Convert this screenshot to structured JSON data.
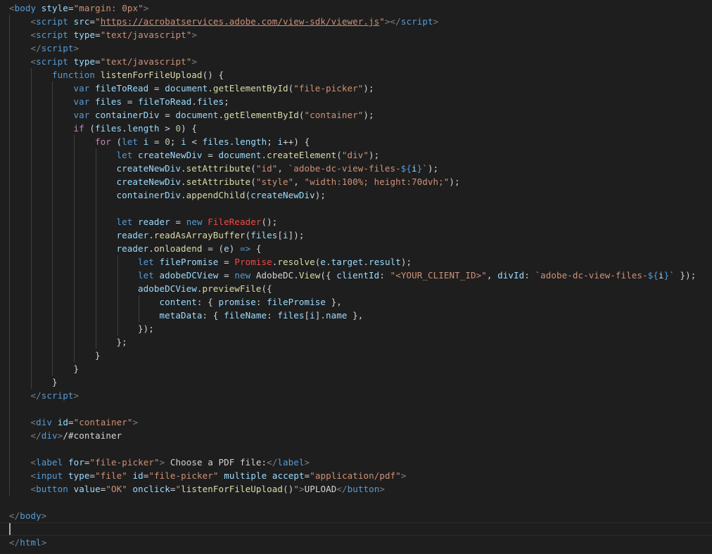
{
  "code_lines": [
    [
      {
        "t": "<",
        "c": "tag-punct"
      },
      {
        "t": "body",
        "c": "tag-name"
      },
      {
        "t": " ",
        "c": "plain"
      },
      {
        "t": "style",
        "c": "attr"
      },
      {
        "t": "=",
        "c": "plain"
      },
      {
        "t": "\"margin: 0px\"",
        "c": "str"
      },
      {
        "t": ">",
        "c": "tag-punct"
      }
    ],
    [
      {
        "t": "    ",
        "c": "plain"
      },
      {
        "t": "<",
        "c": "tag-punct"
      },
      {
        "t": "script",
        "c": "tag-name"
      },
      {
        "t": " ",
        "c": "plain"
      },
      {
        "t": "src",
        "c": "attr"
      },
      {
        "t": "=",
        "c": "plain"
      },
      {
        "t": "\"",
        "c": "str"
      },
      {
        "t": "https://acrobatservices.adobe.com/view-sdk/viewer.js",
        "c": "url"
      },
      {
        "t": "\"",
        "c": "str"
      },
      {
        "t": "></",
        "c": "tag-punct"
      },
      {
        "t": "script",
        "c": "tag-name"
      },
      {
        "t": ">",
        "c": "tag-punct"
      }
    ],
    [
      {
        "t": "    ",
        "c": "plain"
      },
      {
        "t": "<",
        "c": "tag-punct"
      },
      {
        "t": "script",
        "c": "tag-name"
      },
      {
        "t": " ",
        "c": "plain"
      },
      {
        "t": "type",
        "c": "attr"
      },
      {
        "t": "=",
        "c": "plain"
      },
      {
        "t": "\"text/javascript\"",
        "c": "str"
      },
      {
        "t": ">",
        "c": "tag-punct"
      }
    ],
    [
      {
        "t": "    ",
        "c": "plain"
      },
      {
        "t": "</",
        "c": "tag-punct"
      },
      {
        "t": "script",
        "c": "tag-name"
      },
      {
        "t": ">",
        "c": "tag-punct"
      }
    ],
    [
      {
        "t": "    ",
        "c": "plain"
      },
      {
        "t": "<",
        "c": "tag-punct"
      },
      {
        "t": "script",
        "c": "tag-name"
      },
      {
        "t": " ",
        "c": "plain"
      },
      {
        "t": "type",
        "c": "attr"
      },
      {
        "t": "=",
        "c": "plain"
      },
      {
        "t": "\"text/javascript\"",
        "c": "str"
      },
      {
        "t": ">",
        "c": "tag-punct"
      }
    ],
    [
      {
        "t": "        ",
        "c": "plain"
      },
      {
        "t": "function",
        "c": "kw"
      },
      {
        "t": " ",
        "c": "plain"
      },
      {
        "t": "listenForFileUpload",
        "c": "fn"
      },
      {
        "t": "() {",
        "c": "plain"
      }
    ],
    [
      {
        "t": "            ",
        "c": "plain"
      },
      {
        "t": "var",
        "c": "kw"
      },
      {
        "t": " ",
        "c": "plain"
      },
      {
        "t": "fileToRead",
        "c": "var"
      },
      {
        "t": " = ",
        "c": "plain"
      },
      {
        "t": "document",
        "c": "var"
      },
      {
        "t": ".",
        "c": "plain"
      },
      {
        "t": "getElementById",
        "c": "fn"
      },
      {
        "t": "(",
        "c": "plain"
      },
      {
        "t": "\"file-picker\"",
        "c": "str"
      },
      {
        "t": ");",
        "c": "plain"
      }
    ],
    [
      {
        "t": "            ",
        "c": "plain"
      },
      {
        "t": "var",
        "c": "kw"
      },
      {
        "t": " ",
        "c": "plain"
      },
      {
        "t": "files",
        "c": "var"
      },
      {
        "t": " = ",
        "c": "plain"
      },
      {
        "t": "fileToRead",
        "c": "var"
      },
      {
        "t": ".",
        "c": "plain"
      },
      {
        "t": "files",
        "c": "var"
      },
      {
        "t": ";",
        "c": "plain"
      }
    ],
    [
      {
        "t": "            ",
        "c": "plain"
      },
      {
        "t": "var",
        "c": "kw"
      },
      {
        "t": " ",
        "c": "plain"
      },
      {
        "t": "containerDiv",
        "c": "var"
      },
      {
        "t": " = ",
        "c": "plain"
      },
      {
        "t": "document",
        "c": "var"
      },
      {
        "t": ".",
        "c": "plain"
      },
      {
        "t": "getElementById",
        "c": "fn"
      },
      {
        "t": "(",
        "c": "plain"
      },
      {
        "t": "\"container\"",
        "c": "str"
      },
      {
        "t": ");",
        "c": "plain"
      }
    ],
    [
      {
        "t": "            ",
        "c": "plain"
      },
      {
        "t": "if",
        "c": "ctrl"
      },
      {
        "t": " (",
        "c": "plain"
      },
      {
        "t": "files",
        "c": "var"
      },
      {
        "t": ".",
        "c": "plain"
      },
      {
        "t": "length",
        "c": "var"
      },
      {
        "t": " > ",
        "c": "plain"
      },
      {
        "t": "0",
        "c": "num"
      },
      {
        "t": ") {",
        "c": "plain"
      }
    ],
    [
      {
        "t": "                ",
        "c": "plain"
      },
      {
        "t": "for",
        "c": "ctrl"
      },
      {
        "t": " (",
        "c": "plain"
      },
      {
        "t": "let",
        "c": "kw"
      },
      {
        "t": " ",
        "c": "plain"
      },
      {
        "t": "i",
        "c": "var"
      },
      {
        "t": " = ",
        "c": "plain"
      },
      {
        "t": "0",
        "c": "num"
      },
      {
        "t": "; ",
        "c": "plain"
      },
      {
        "t": "i",
        "c": "var"
      },
      {
        "t": " < ",
        "c": "plain"
      },
      {
        "t": "files",
        "c": "var"
      },
      {
        "t": ".",
        "c": "plain"
      },
      {
        "t": "length",
        "c": "var"
      },
      {
        "t": "; ",
        "c": "plain"
      },
      {
        "t": "i",
        "c": "var"
      },
      {
        "t": "++) {",
        "c": "plain"
      }
    ],
    [
      {
        "t": "                    ",
        "c": "plain"
      },
      {
        "t": "let",
        "c": "kw"
      },
      {
        "t": " ",
        "c": "plain"
      },
      {
        "t": "createNewDiv",
        "c": "var"
      },
      {
        "t": " = ",
        "c": "plain"
      },
      {
        "t": "document",
        "c": "var"
      },
      {
        "t": ".",
        "c": "plain"
      },
      {
        "t": "createElement",
        "c": "fn"
      },
      {
        "t": "(",
        "c": "plain"
      },
      {
        "t": "\"div\"",
        "c": "str"
      },
      {
        "t": ");",
        "c": "plain"
      }
    ],
    [
      {
        "t": "                    ",
        "c": "plain"
      },
      {
        "t": "createNewDiv",
        "c": "var"
      },
      {
        "t": ".",
        "c": "plain"
      },
      {
        "t": "setAttribute",
        "c": "fn"
      },
      {
        "t": "(",
        "c": "plain"
      },
      {
        "t": "\"id\"",
        "c": "str"
      },
      {
        "t": ", ",
        "c": "plain"
      },
      {
        "t": "`adobe-dc-view-files-",
        "c": "str"
      },
      {
        "t": "${",
        "c": "kw"
      },
      {
        "t": "i",
        "c": "var"
      },
      {
        "t": "}",
        "c": "kw"
      },
      {
        "t": "`",
        "c": "str"
      },
      {
        "t": ");",
        "c": "plain"
      }
    ],
    [
      {
        "t": "                    ",
        "c": "plain"
      },
      {
        "t": "createNewDiv",
        "c": "var"
      },
      {
        "t": ".",
        "c": "plain"
      },
      {
        "t": "setAttribute",
        "c": "fn"
      },
      {
        "t": "(",
        "c": "plain"
      },
      {
        "t": "\"style\"",
        "c": "str"
      },
      {
        "t": ", ",
        "c": "plain"
      },
      {
        "t": "\"width:100%; height:70dvh;\"",
        "c": "str"
      },
      {
        "t": ");",
        "c": "plain"
      }
    ],
    [
      {
        "t": "                    ",
        "c": "plain"
      },
      {
        "t": "containerDiv",
        "c": "var"
      },
      {
        "t": ".",
        "c": "plain"
      },
      {
        "t": "appendChild",
        "c": "fn"
      },
      {
        "t": "(",
        "c": "plain"
      },
      {
        "t": "createNewDiv",
        "c": "var"
      },
      {
        "t": ");",
        "c": "plain"
      }
    ],
    [
      {
        "t": "",
        "c": "plain"
      }
    ],
    [
      {
        "t": "                    ",
        "c": "plain"
      },
      {
        "t": "let",
        "c": "kw"
      },
      {
        "t": " ",
        "c": "plain"
      },
      {
        "t": "reader",
        "c": "var"
      },
      {
        "t": " = ",
        "c": "plain"
      },
      {
        "t": "new",
        "c": "kw"
      },
      {
        "t": " ",
        "c": "plain"
      },
      {
        "t": "FileReader",
        "c": "err"
      },
      {
        "t": "();",
        "c": "plain"
      }
    ],
    [
      {
        "t": "                    ",
        "c": "plain"
      },
      {
        "t": "reader",
        "c": "var"
      },
      {
        "t": ".",
        "c": "plain"
      },
      {
        "t": "readAsArrayBuffer",
        "c": "fn"
      },
      {
        "t": "(",
        "c": "plain"
      },
      {
        "t": "files",
        "c": "var"
      },
      {
        "t": "[",
        "c": "plain"
      },
      {
        "t": "i",
        "c": "var"
      },
      {
        "t": "]);",
        "c": "plain"
      }
    ],
    [
      {
        "t": "                    ",
        "c": "plain"
      },
      {
        "t": "reader",
        "c": "var"
      },
      {
        "t": ".",
        "c": "plain"
      },
      {
        "t": "onloadend",
        "c": "fn"
      },
      {
        "t": " = (",
        "c": "plain"
      },
      {
        "t": "e",
        "c": "var"
      },
      {
        "t": ") ",
        "c": "plain"
      },
      {
        "t": "=>",
        "c": "kw"
      },
      {
        "t": " {",
        "c": "plain"
      }
    ],
    [
      {
        "t": "                        ",
        "c": "plain"
      },
      {
        "t": "let",
        "c": "kw"
      },
      {
        "t": " ",
        "c": "plain"
      },
      {
        "t": "filePromise",
        "c": "var"
      },
      {
        "t": " = ",
        "c": "plain"
      },
      {
        "t": "Promise",
        "c": "err"
      },
      {
        "t": ".",
        "c": "plain"
      },
      {
        "t": "resolve",
        "c": "fn"
      },
      {
        "t": "(",
        "c": "plain"
      },
      {
        "t": "e",
        "c": "var"
      },
      {
        "t": ".",
        "c": "plain"
      },
      {
        "t": "target",
        "c": "var"
      },
      {
        "t": ".",
        "c": "plain"
      },
      {
        "t": "result",
        "c": "var"
      },
      {
        "t": ");",
        "c": "plain"
      }
    ],
    [
      {
        "t": "                        ",
        "c": "plain"
      },
      {
        "t": "let",
        "c": "kw"
      },
      {
        "t": " ",
        "c": "plain"
      },
      {
        "t": "adobeDCView",
        "c": "var"
      },
      {
        "t": " = ",
        "c": "plain"
      },
      {
        "t": "new",
        "c": "kw"
      },
      {
        "t": " ",
        "c": "plain"
      },
      {
        "t": "AdobeDC",
        "c": "plain"
      },
      {
        "t": ".",
        "c": "plain"
      },
      {
        "t": "View",
        "c": "fn"
      },
      {
        "t": "({ ",
        "c": "plain"
      },
      {
        "t": "clientId",
        "c": "var"
      },
      {
        "t": ": ",
        "c": "plain"
      },
      {
        "t": "\"<YOUR_CLIENT_ID>\"",
        "c": "str"
      },
      {
        "t": ", ",
        "c": "plain"
      },
      {
        "t": "divId",
        "c": "var"
      },
      {
        "t": ": ",
        "c": "plain"
      },
      {
        "t": "`adobe-dc-view-files-",
        "c": "str"
      },
      {
        "t": "${",
        "c": "kw"
      },
      {
        "t": "i",
        "c": "var"
      },
      {
        "t": "}",
        "c": "kw"
      },
      {
        "t": "`",
        "c": "str"
      },
      {
        "t": " });",
        "c": "plain"
      }
    ],
    [
      {
        "t": "                        ",
        "c": "plain"
      },
      {
        "t": "adobeDCView",
        "c": "var"
      },
      {
        "t": ".",
        "c": "plain"
      },
      {
        "t": "previewFile",
        "c": "fn"
      },
      {
        "t": "({",
        "c": "plain"
      }
    ],
    [
      {
        "t": "                            ",
        "c": "plain"
      },
      {
        "t": "content",
        "c": "var"
      },
      {
        "t": ": { ",
        "c": "plain"
      },
      {
        "t": "promise",
        "c": "var"
      },
      {
        "t": ": ",
        "c": "plain"
      },
      {
        "t": "filePromise",
        "c": "var"
      },
      {
        "t": " },",
        "c": "plain"
      }
    ],
    [
      {
        "t": "                            ",
        "c": "plain"
      },
      {
        "t": "metaData",
        "c": "var"
      },
      {
        "t": ": { ",
        "c": "plain"
      },
      {
        "t": "fileName",
        "c": "var"
      },
      {
        "t": ": ",
        "c": "plain"
      },
      {
        "t": "files",
        "c": "var"
      },
      {
        "t": "[",
        "c": "plain"
      },
      {
        "t": "i",
        "c": "var"
      },
      {
        "t": "].",
        "c": "plain"
      },
      {
        "t": "name",
        "c": "var"
      },
      {
        "t": " },",
        "c": "plain"
      }
    ],
    [
      {
        "t": "                        ",
        "c": "plain"
      },
      {
        "t": "});",
        "c": "plain"
      }
    ],
    [
      {
        "t": "                    ",
        "c": "plain"
      },
      {
        "t": "};",
        "c": "plain"
      }
    ],
    [
      {
        "t": "                ",
        "c": "plain"
      },
      {
        "t": "}",
        "c": "plain"
      }
    ],
    [
      {
        "t": "            ",
        "c": "plain"
      },
      {
        "t": "}",
        "c": "plain"
      }
    ],
    [
      {
        "t": "        ",
        "c": "plain"
      },
      {
        "t": "}",
        "c": "plain"
      }
    ],
    [
      {
        "t": "    ",
        "c": "plain"
      },
      {
        "t": "</",
        "c": "tag-punct"
      },
      {
        "t": "script",
        "c": "tag-name"
      },
      {
        "t": ">",
        "c": "tag-punct"
      }
    ],
    [
      {
        "t": "",
        "c": "plain"
      }
    ],
    [
      {
        "t": "    ",
        "c": "plain"
      },
      {
        "t": "<",
        "c": "tag-punct"
      },
      {
        "t": "div",
        "c": "tag-name"
      },
      {
        "t": " ",
        "c": "plain"
      },
      {
        "t": "id",
        "c": "attr"
      },
      {
        "t": "=",
        "c": "plain"
      },
      {
        "t": "\"container\"",
        "c": "str"
      },
      {
        "t": ">",
        "c": "tag-punct"
      }
    ],
    [
      {
        "t": "    ",
        "c": "plain"
      },
      {
        "t": "</",
        "c": "tag-punct"
      },
      {
        "t": "div",
        "c": "tag-name"
      },
      {
        "t": ">",
        "c": "tag-punct"
      },
      {
        "t": "/#container",
        "c": "plain"
      }
    ],
    [
      {
        "t": "",
        "c": "plain"
      }
    ],
    [
      {
        "t": "    ",
        "c": "plain"
      },
      {
        "t": "<",
        "c": "tag-punct"
      },
      {
        "t": "label",
        "c": "tag-name"
      },
      {
        "t": " ",
        "c": "plain"
      },
      {
        "t": "for",
        "c": "attr"
      },
      {
        "t": "=",
        "c": "plain"
      },
      {
        "t": "\"file-picker\"",
        "c": "str"
      },
      {
        "t": ">",
        "c": "tag-punct"
      },
      {
        "t": " Choose a PDF file:",
        "c": "plain"
      },
      {
        "t": "</",
        "c": "tag-punct"
      },
      {
        "t": "label",
        "c": "tag-name"
      },
      {
        "t": ">",
        "c": "tag-punct"
      }
    ],
    [
      {
        "t": "    ",
        "c": "plain"
      },
      {
        "t": "<",
        "c": "tag-punct"
      },
      {
        "t": "input",
        "c": "tag-name"
      },
      {
        "t": " ",
        "c": "plain"
      },
      {
        "t": "type",
        "c": "attr"
      },
      {
        "t": "=",
        "c": "plain"
      },
      {
        "t": "\"file\"",
        "c": "str"
      },
      {
        "t": " ",
        "c": "plain"
      },
      {
        "t": "id",
        "c": "attr"
      },
      {
        "t": "=",
        "c": "plain"
      },
      {
        "t": "\"file-picker\"",
        "c": "str"
      },
      {
        "t": " ",
        "c": "plain"
      },
      {
        "t": "multiple",
        "c": "attr"
      },
      {
        "t": " ",
        "c": "plain"
      },
      {
        "t": "accept",
        "c": "attr"
      },
      {
        "t": "=",
        "c": "plain"
      },
      {
        "t": "\"application/pdf\"",
        "c": "str"
      },
      {
        "t": ">",
        "c": "tag-punct"
      }
    ],
    [
      {
        "t": "    ",
        "c": "plain"
      },
      {
        "t": "<",
        "c": "tag-punct"
      },
      {
        "t": "button",
        "c": "tag-name"
      },
      {
        "t": " ",
        "c": "plain"
      },
      {
        "t": "value",
        "c": "attr"
      },
      {
        "t": "=",
        "c": "plain"
      },
      {
        "t": "\"OK\"",
        "c": "str"
      },
      {
        "t": " ",
        "c": "plain"
      },
      {
        "t": "onclick",
        "c": "attr"
      },
      {
        "t": "=",
        "c": "plain"
      },
      {
        "t": "\"",
        "c": "str"
      },
      {
        "t": "listenForFileUpload",
        "c": "fn"
      },
      {
        "t": "()",
        "c": "plain"
      },
      {
        "t": "\"",
        "c": "str"
      },
      {
        "t": ">",
        "c": "tag-punct"
      },
      {
        "t": "UPLOAD",
        "c": "plain"
      },
      {
        "t": "</",
        "c": "tag-punct"
      },
      {
        "t": "button",
        "c": "tag-name"
      },
      {
        "t": ">",
        "c": "tag-punct"
      }
    ],
    [
      {
        "t": "",
        "c": "plain"
      }
    ],
    [
      {
        "t": "</",
        "c": "tag-punct"
      },
      {
        "t": "body",
        "c": "tag-name"
      },
      {
        "t": ">",
        "c": "tag-punct"
      }
    ],
    [
      {
        "t": "",
        "c": "plain"
      }
    ],
    [
      {
        "t": "</",
        "c": "tag-punct"
      },
      {
        "t": "html",
        "c": "tag-name"
      },
      {
        "t": ">",
        "c": "tag-punct"
      }
    ]
  ]
}
